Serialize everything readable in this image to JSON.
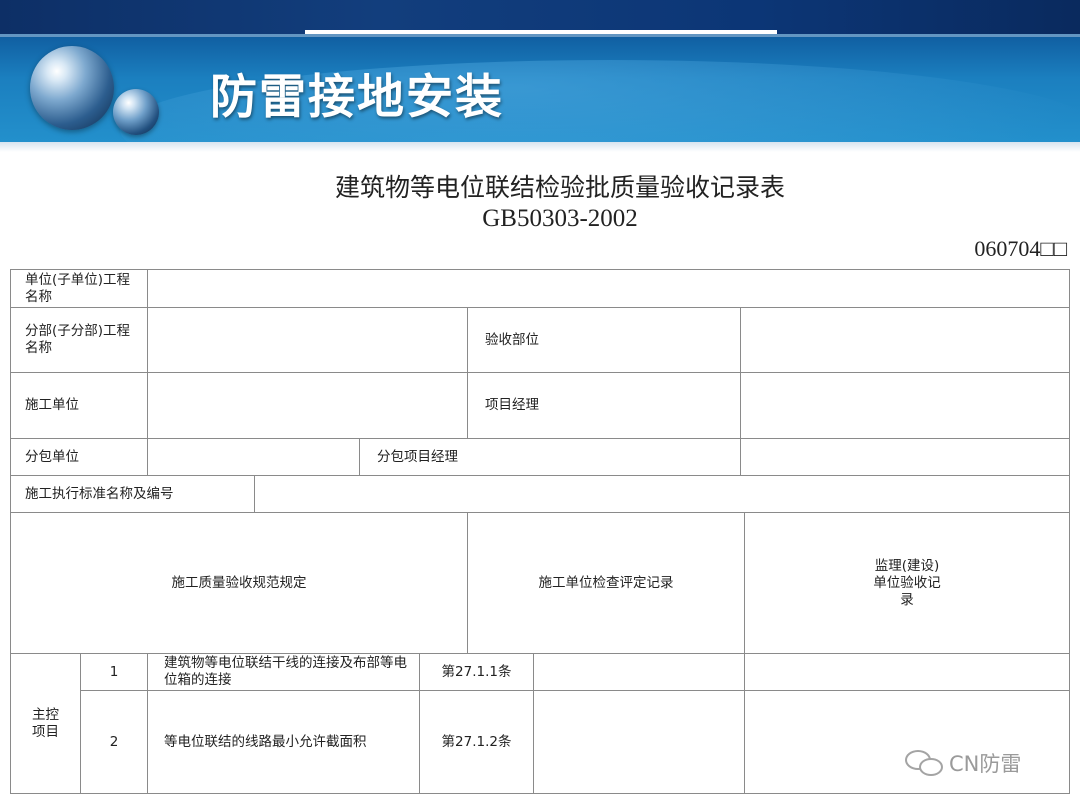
{
  "banner": {
    "title": "防雷接地安装"
  },
  "document": {
    "title": "建筑物等电位联结检验批质量验收记录表",
    "standard": "GB50303-2002",
    "form_code": "060704□□"
  },
  "table": {
    "labels": {
      "unit_project_name": "单位(子单位)工程名称",
      "sub_project_name": "分部(子分部)工程名称",
      "acceptance_part": "验收部位",
      "construction_unit": "施工单位",
      "project_manager": "项目经理",
      "subcontract_unit": "分包单位",
      "subcontract_manager": "分包项目经理",
      "standard_name": "施工执行标准名称及编号",
      "quality_spec": "施工质量验收规范规定",
      "unit_check_record": "施工单位检查评定记录",
      "supervision_record": "监理(建设)单位验收记录",
      "main_items": "主控项目"
    },
    "main_items": [
      {
        "no": "1",
        "desc": "建筑物等电位联结干线的连接及布部等电位箱的连接",
        "clause": "第27.1.1条"
      },
      {
        "no": "2",
        "desc": "等电位联结的线路最小允许截面积",
        "clause": "第27.1.2条"
      }
    ]
  },
  "watermark": {
    "text": "CN防雷"
  }
}
